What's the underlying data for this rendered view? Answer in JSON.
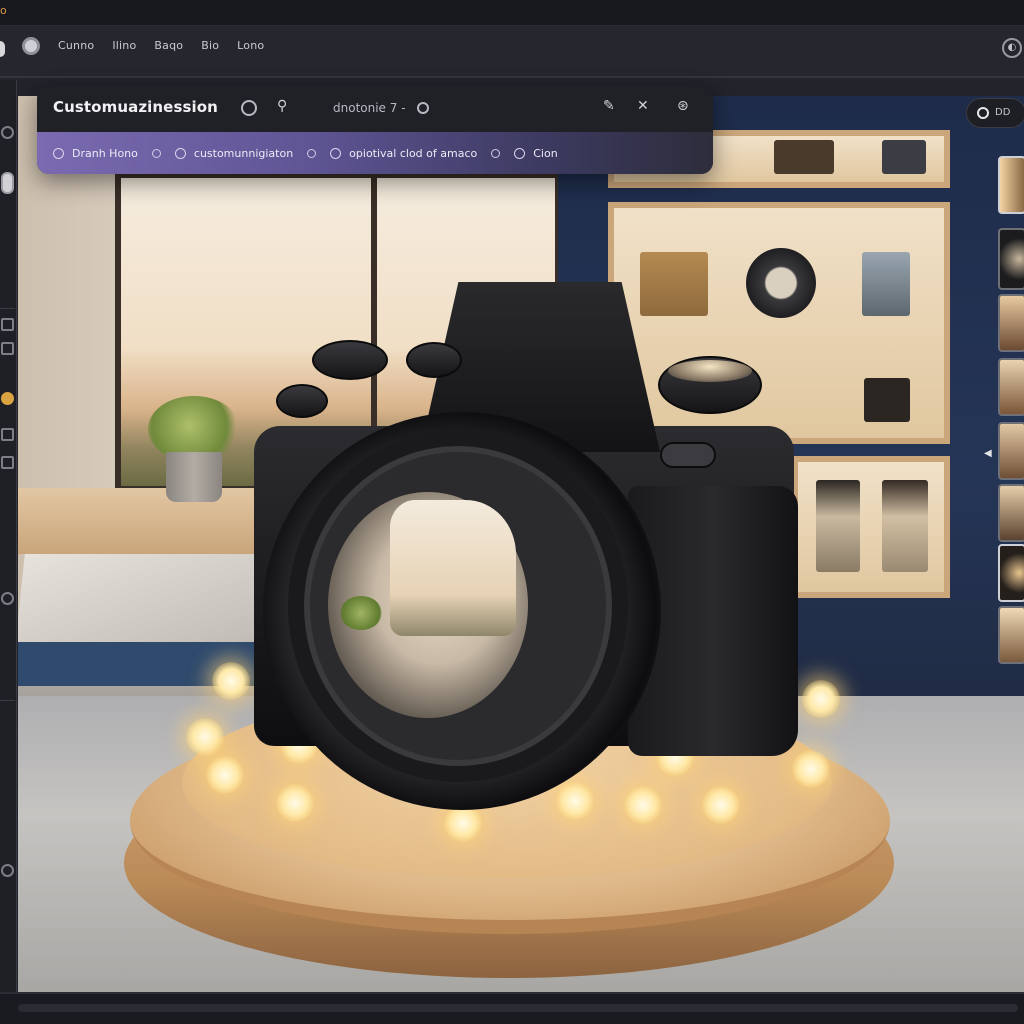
{
  "window": {
    "app_mark": "o"
  },
  "menu": {
    "items": [
      "Cunno",
      "Ilino",
      "Baqo",
      "Bio",
      "Lono"
    ]
  },
  "panel": {
    "title": "Customuazinession",
    "subtitle": "dnotonie 7 -",
    "tabs": [
      {
        "label": "Dranh Hono"
      },
      {
        "label": "customunnigiaton"
      },
      {
        "label": "opiotival clod of amaco"
      },
      {
        "label": "Cion"
      }
    ]
  },
  "chip": {
    "label": "DD"
  },
  "icons": {
    "rail": [
      "select-icon",
      "move-icon",
      "pen-icon",
      "pen-icon",
      "color-icon",
      "brush-icon",
      "brush-icon",
      "zoom-icon",
      "settings-icon"
    ],
    "panel": [
      "circle-icon",
      "pin-icon",
      "circle-icon",
      "edit-icon",
      "close-icon",
      "layers-icon"
    ]
  },
  "colors": {
    "accent_gradient_start": "#7b6ab0",
    "accent_gradient_end": "#2d2d3b",
    "gold_tool": "#d9a441"
  }
}
